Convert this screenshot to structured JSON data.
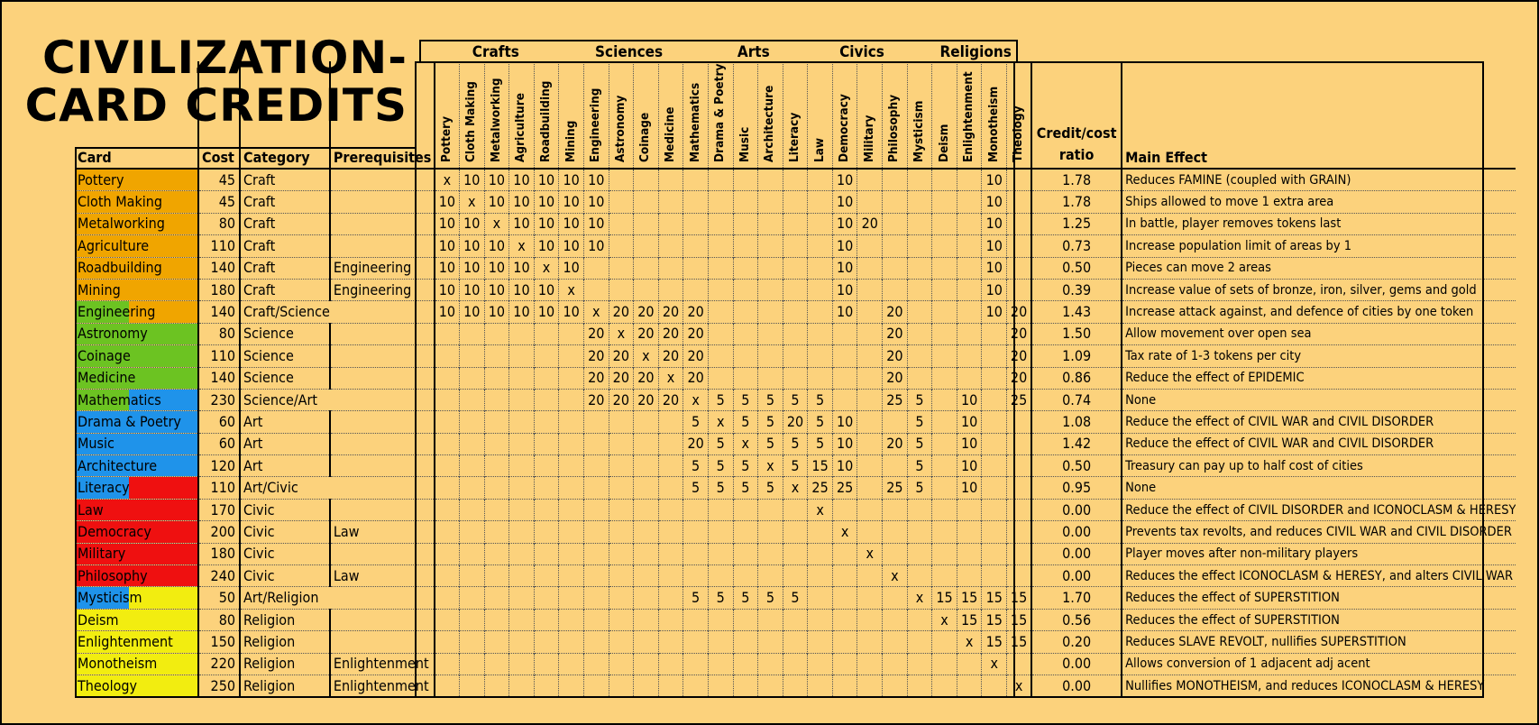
{
  "title": "CIVILIZATION-\nCARD CREDITS",
  "group_headers": [
    "Crafts",
    "Sciences",
    "Arts",
    "Civics",
    "Religions"
  ],
  "columns": {
    "card": "Card",
    "cost": "Cost",
    "category": "Category",
    "prerequisites": "Prerequisites",
    "ratio": "Credit/cost\nratio",
    "effect": "Main Effect"
  },
  "credit_columns": [
    "Pottery",
    "Cloth Making",
    "Metalworking",
    "Agriculture",
    "Roadbuilding",
    "Mining",
    "Engineering",
    "Astronomy",
    "Coinage",
    "Medicine",
    "Mathematics",
    "Drama & Poetry",
    "Music",
    "Architecture",
    "Literacy",
    "Law",
    "Democracy",
    "Military",
    "Philosophy",
    "Mysticism",
    "Deism",
    "Enlightenment",
    "Monotheism",
    "Theology"
  ],
  "colors": {
    "background": "#fcd27c",
    "Craft": "#f0a500",
    "Science": "#6cc322",
    "Art": "#1f93ea",
    "Civic": "#ef1010",
    "Religion": "#f2ed10"
  },
  "rows": [
    {
      "card": "Pottery",
      "cost": "45",
      "category": "Craft",
      "prereq": "",
      "colors": [
        "Craft"
      ],
      "credits": [
        "x",
        "10",
        "10",
        "10",
        "10",
        "10",
        "10",
        "",
        "",
        "",
        "",
        "",
        "",
        "",
        "",
        "",
        "10",
        "",
        "",
        "",
        "",
        "",
        "10",
        ""
      ],
      "ratio": "1.78",
      "effect": "Reduces FAMINE (coupled with GRAIN)"
    },
    {
      "card": "Cloth Making",
      "cost": "45",
      "category": "Craft",
      "prereq": "",
      "colors": [
        "Craft"
      ],
      "credits": [
        "10",
        "x",
        "10",
        "10",
        "10",
        "10",
        "10",
        "",
        "",
        "",
        "",
        "",
        "",
        "",
        "",
        "",
        "10",
        "",
        "",
        "",
        "",
        "",
        "10",
        ""
      ],
      "ratio": "1.78",
      "effect": "Ships allowed to move 1 extra area"
    },
    {
      "card": "Metalworking",
      "cost": "80",
      "category": "Craft",
      "prereq": "",
      "colors": [
        "Craft"
      ],
      "credits": [
        "10",
        "10",
        "x",
        "10",
        "10",
        "10",
        "10",
        "",
        "",
        "",
        "",
        "",
        "",
        "",
        "",
        "",
        "10",
        "20",
        "",
        "",
        "",
        "",
        "10",
        ""
      ],
      "ratio": "1.25",
      "effect": "In battle, player removes tokens last"
    },
    {
      "card": "Agriculture",
      "cost": "110",
      "category": "Craft",
      "prereq": "",
      "colors": [
        "Craft"
      ],
      "credits": [
        "10",
        "10",
        "10",
        "x",
        "10",
        "10",
        "10",
        "",
        "",
        "",
        "",
        "",
        "",
        "",
        "",
        "",
        "10",
        "",
        "",
        "",
        "",
        "",
        "10",
        ""
      ],
      "ratio": "0.73",
      "effect": "Increase population limit of areas by 1"
    },
    {
      "card": "Roadbuilding",
      "cost": "140",
      "category": "Craft",
      "prereq": "Engineering",
      "colors": [
        "Craft"
      ],
      "credits": [
        "10",
        "10",
        "10",
        "10",
        "x",
        "10",
        "",
        "",
        "",
        "",
        "",
        "",
        "",
        "",
        "",
        "",
        "10",
        "",
        "",
        "",
        "",
        "",
        "10",
        ""
      ],
      "ratio": "0.50",
      "effect": "Pieces can move 2 areas"
    },
    {
      "card": "Mining",
      "cost": "180",
      "category": "Craft",
      "prereq": "Engineering",
      "colors": [
        "Craft"
      ],
      "credits": [
        "10",
        "10",
        "10",
        "10",
        "10",
        "x",
        "",
        "",
        "",
        "",
        "",
        "",
        "",
        "",
        "",
        "",
        "10",
        "",
        "",
        "",
        "",
        "",
        "10",
        ""
      ],
      "ratio": "0.39",
      "effect": "Increase value of sets of bronze, iron, silver, gems and gold"
    },
    {
      "card": "Engineering",
      "cost": "140",
      "category": "Craft/Science",
      "prereq": "",
      "colors": [
        "Science",
        "Craft"
      ],
      "credits": [
        "10",
        "10",
        "10",
        "10",
        "10",
        "10",
        "x",
        "20",
        "20",
        "20",
        "20",
        "",
        "",
        "",
        "",
        "",
        "10",
        "",
        "20",
        "",
        "",
        "",
        "10",
        "20"
      ],
      "ratio": "1.43",
      "effect": "Increase attack against, and defence of cities by one token"
    },
    {
      "card": "Astronomy",
      "cost": "80",
      "category": "Science",
      "prereq": "",
      "colors": [
        "Science"
      ],
      "credits": [
        "",
        "",
        "",
        "",
        "",
        "",
        "20",
        "x",
        "20",
        "20",
        "20",
        "",
        "",
        "",
        "",
        "",
        "",
        "",
        "20",
        "",
        "",
        "",
        "",
        "20"
      ],
      "ratio": "1.50",
      "effect": "Allow movement over open sea"
    },
    {
      "card": "Coinage",
      "cost": "110",
      "category": "Science",
      "prereq": "",
      "colors": [
        "Science"
      ],
      "credits": [
        "",
        "",
        "",
        "",
        "",
        "",
        "20",
        "20",
        "x",
        "20",
        "20",
        "",
        "",
        "",
        "",
        "",
        "",
        "",
        "20",
        "",
        "",
        "",
        "",
        "20"
      ],
      "ratio": "1.09",
      "effect": "Tax rate of 1-3 tokens per city"
    },
    {
      "card": "Medicine",
      "cost": "140",
      "category": "Science",
      "prereq": "",
      "colors": [
        "Science"
      ],
      "credits": [
        "",
        "",
        "",
        "",
        "",
        "",
        "20",
        "20",
        "20",
        "x",
        "20",
        "",
        "",
        "",
        "",
        "",
        "",
        "",
        "20",
        "",
        "",
        "",
        "",
        "20"
      ],
      "ratio": "0.86",
      "effect": "Reduce the effect of EPIDEMIC"
    },
    {
      "card": "Mathematics",
      "cost": "230",
      "category": "Science/Art",
      "prereq": "",
      "colors": [
        "Science",
        "Art"
      ],
      "credits": [
        "",
        "",
        "",
        "",
        "",
        "",
        "20",
        "20",
        "20",
        "20",
        "x",
        "5",
        "5",
        "5",
        "5",
        "5",
        "",
        "",
        "25",
        "5",
        "",
        "10",
        "",
        "25"
      ],
      "ratio": "0.74",
      "effect": "None"
    },
    {
      "card": "Drama & Poetry",
      "cost": "60",
      "category": "Art",
      "prereq": "",
      "colors": [
        "Art"
      ],
      "credits": [
        "",
        "",
        "",
        "",
        "",
        "",
        "",
        "",
        "",
        "",
        "5",
        "x",
        "5",
        "5",
        "20",
        "5",
        "10",
        "",
        "",
        "5",
        "",
        "10",
        "",
        ""
      ],
      "ratio": "1.08",
      "effect": "Reduce the effect of CIVIL WAR and CIVIL DISORDER"
    },
    {
      "card": "Music",
      "cost": "60",
      "category": "Art",
      "prereq": "",
      "colors": [
        "Art"
      ],
      "credits": [
        "",
        "",
        "",
        "",
        "",
        "",
        "",
        "",
        "",
        "",
        "20",
        "5",
        "x",
        "5",
        "5",
        "5",
        "10",
        "",
        "20",
        "5",
        "",
        "10",
        "",
        ""
      ],
      "ratio": "1.42",
      "effect": "Reduce the effect of CIVIL WAR and CIVIL DISORDER"
    },
    {
      "card": "Architecture",
      "cost": "120",
      "category": "Art",
      "prereq": "",
      "colors": [
        "Art"
      ],
      "credits": [
        "",
        "",
        "",
        "",
        "",
        "",
        "",
        "",
        "",
        "",
        "5",
        "5",
        "5",
        "x",
        "5",
        "15",
        "10",
        "",
        "",
        "5",
        "",
        "10",
        "",
        ""
      ],
      "ratio": "0.50",
      "effect": "Treasury can pay up to half cost of cities"
    },
    {
      "card": "Literacy",
      "cost": "110",
      "category": "Art/Civic",
      "prereq": "",
      "colors": [
        "Art",
        "Civic"
      ],
      "credits": [
        "",
        "",
        "",
        "",
        "",
        "",
        "",
        "",
        "",
        "",
        "5",
        "5",
        "5",
        "5",
        "x",
        "25",
        "25",
        "",
        "25",
        "5",
        "",
        "10",
        "",
        ""
      ],
      "ratio": "0.95",
      "effect": "None"
    },
    {
      "card": "Law",
      "cost": "170",
      "category": "Civic",
      "prereq": "",
      "colors": [
        "Civic"
      ],
      "credits": [
        "",
        "",
        "",
        "",
        "",
        "",
        "",
        "",
        "",
        "",
        "",
        "",
        "",
        "",
        "",
        "x",
        "",
        "",
        "",
        "",
        "",
        "",
        "",
        ""
      ],
      "ratio": "0.00",
      "effect": "Reduce the effect of CIVIL DISORDER and ICONOCLASM & HERESY"
    },
    {
      "card": "Democracy",
      "cost": "200",
      "category": "Civic",
      "prereq": "Law",
      "colors": [
        "Civic"
      ],
      "credits": [
        "",
        "",
        "",
        "",
        "",
        "",
        "",
        "",
        "",
        "",
        "",
        "",
        "",
        "",
        "",
        "",
        "x",
        "",
        "",
        "",
        "",
        "",
        "",
        ""
      ],
      "ratio": "0.00",
      "effect": "Prevents tax revolts, and reduces CIVIL WAR and CIVIL DISORDER"
    },
    {
      "card": "Military",
      "cost": "180",
      "category": "Civic",
      "prereq": "",
      "colors": [
        "Civic"
      ],
      "credits": [
        "",
        "",
        "",
        "",
        "",
        "",
        "",
        "",
        "",
        "",
        "",
        "",
        "",
        "",
        "",
        "",
        "",
        "x",
        "",
        "",
        "",
        "",
        "",
        ""
      ],
      "ratio": "0.00",
      "effect": "Player moves after non-military players"
    },
    {
      "card": "Philosophy",
      "cost": "240",
      "category": "Civic",
      "prereq": "Law",
      "colors": [
        "Civic"
      ],
      "credits": [
        "",
        "",
        "",
        "",
        "",
        "",
        "",
        "",
        "",
        "",
        "",
        "",
        "",
        "",
        "",
        "",
        "",
        "",
        "x",
        "",
        "",
        "",
        "",
        ""
      ],
      "ratio": "0.00",
      "effect": "Reduces the effect ICONOCLASM & HERESY, and alters CIVIL WAR"
    },
    {
      "card": "Mysticism",
      "cost": "50",
      "category": "Art/Religion",
      "prereq": "",
      "colors": [
        "Art",
        "Religion"
      ],
      "credits": [
        "",
        "",
        "",
        "",
        "",
        "",
        "",
        "",
        "",
        "",
        "5",
        "5",
        "5",
        "5",
        "5",
        "",
        "",
        "",
        "",
        "x",
        "15",
        "15",
        "15",
        "15"
      ],
      "ratio": "1.70",
      "effect": "Reduces the effect of SUPERSTITION"
    },
    {
      "card": "Deism",
      "cost": "80",
      "category": "Religion",
      "prereq": "",
      "colors": [
        "Religion"
      ],
      "credits": [
        "",
        "",
        "",
        "",
        "",
        "",
        "",
        "",
        "",
        "",
        "",
        "",
        "",
        "",
        "",
        "",
        "",
        "",
        "",
        "",
        "x",
        "15",
        "15",
        "15"
      ],
      "ratio": "0.56",
      "effect": "Reduces the effect of SUPERSTITION"
    },
    {
      "card": "Enlightenment",
      "cost": "150",
      "category": "Religion",
      "prereq": "",
      "colors": [
        "Religion"
      ],
      "credits": [
        "",
        "",
        "",
        "",
        "",
        "",
        "",
        "",
        "",
        "",
        "",
        "",
        "",
        "",
        "",
        "",
        "",
        "",
        "",
        "",
        "",
        "x",
        "15",
        "15"
      ],
      "ratio": "0.20",
      "effect": "Reduces SLAVE REVOLT, nullifies SUPERSTITION"
    },
    {
      "card": "Monotheism",
      "cost": "220",
      "category": "Religion",
      "prereq": "Enlightenment",
      "colors": [
        "Religion"
      ],
      "credits": [
        "",
        "",
        "",
        "",
        "",
        "",
        "",
        "",
        "",
        "",
        "",
        "",
        "",
        "",
        "",
        "",
        "",
        "",
        "",
        "",
        "",
        "",
        "x",
        ""
      ],
      "ratio": "0.00",
      "effect": "Allows conversion of 1 adjacent adj acent"
    },
    {
      "card": "Theology",
      "cost": "250",
      "category": "Religion",
      "prereq": "Enlightenment",
      "colors": [
        "Religion"
      ],
      "credits": [
        "",
        "",
        "",
        "",
        "",
        "",
        "",
        "",
        "",
        "",
        "",
        "",
        "",
        "",
        "",
        "",
        "",
        "",
        "",
        "",
        "",
        "",
        "",
        "x"
      ],
      "ratio": "0.00",
      "effect": "Nullifies MONOTHEISM, and reduces ICONOCLASM & HERESY"
    }
  ]
}
